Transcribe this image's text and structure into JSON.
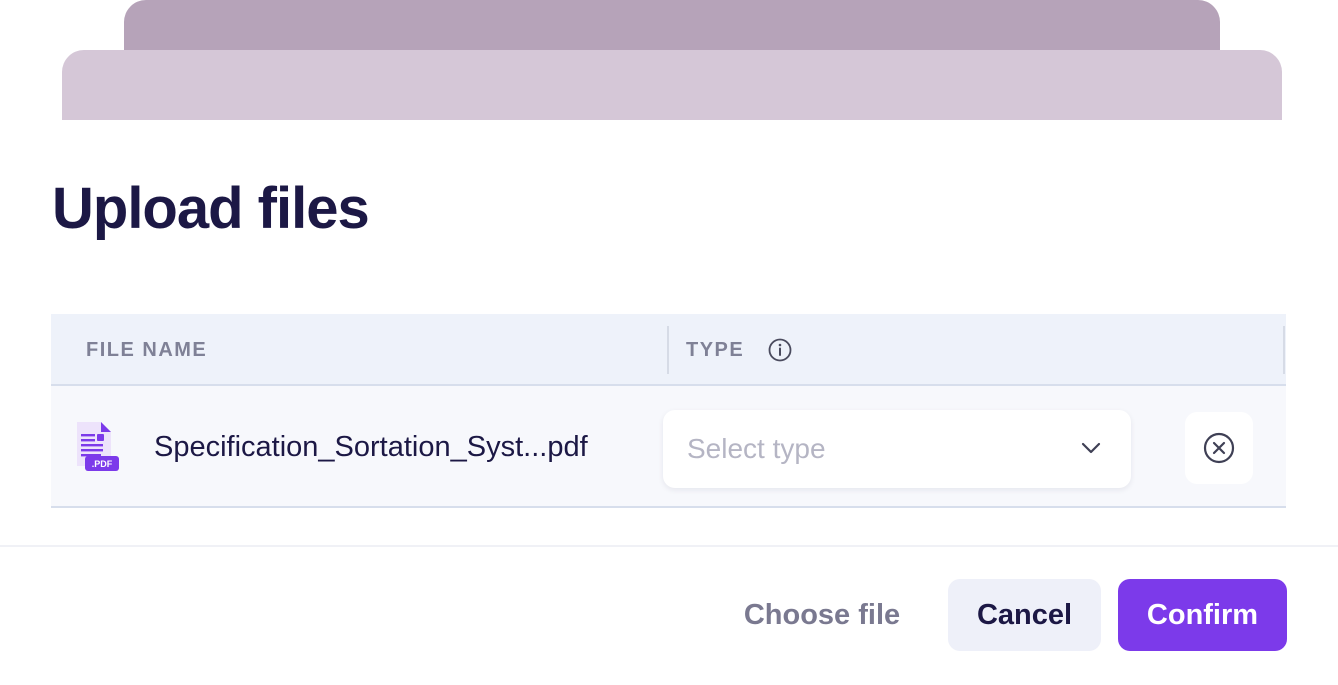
{
  "dialog": {
    "title": "Upload files"
  },
  "table": {
    "columns": {
      "file_name": "FILE NAME",
      "type": "TYPE"
    },
    "rows": [
      {
        "file_name": "Specification_Sortation_Syst...pdf",
        "file_badge": ".PDF",
        "type_placeholder": "Select type"
      }
    ]
  },
  "footer": {
    "choose_file_label": "Choose file",
    "cancel_label": "Cancel",
    "confirm_label": "Confirm"
  },
  "icons": {
    "info": "info-icon",
    "file": "pdf-file-icon",
    "chevron": "chevron-down-icon",
    "remove": "close-circle-icon"
  },
  "colors": {
    "title": "#1c1845",
    "accent": "#7c3aea",
    "back_card": "#b6a3b9",
    "mid_card": "#d5c7d7",
    "header_bg": "#eef2fa"
  }
}
